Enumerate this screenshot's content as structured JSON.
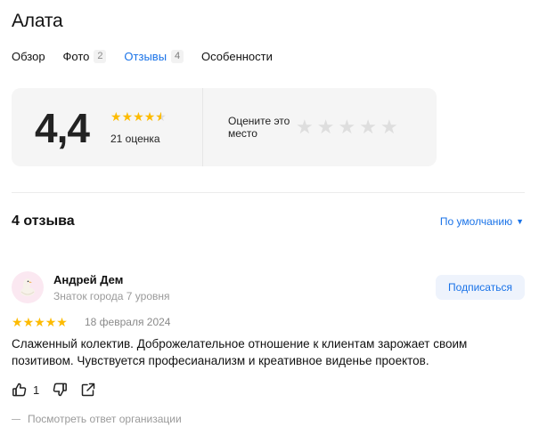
{
  "place": {
    "title": "Алата"
  },
  "tabs": [
    {
      "label": "Обзор",
      "count": ""
    },
    {
      "label": "Фото",
      "count": "2"
    },
    {
      "label": "Отзывы",
      "count": "4"
    },
    {
      "label": "Особенности",
      "count": ""
    }
  ],
  "active_tab": "Отзывы",
  "rating": {
    "score": "4,4",
    "stars_value": 4.4,
    "count_label": "21 оценка",
    "rate_prompt": "Оцените это место",
    "rate_stars": 5
  },
  "reviews_section": {
    "heading": "4 отзыва",
    "sort_label": "По умолчанию"
  },
  "review": {
    "author": "Андрей Дем",
    "level": "Знаток города 7 уровня",
    "subscribe_label": "Подписаться",
    "stars": 5,
    "date": "18 февраля 2024",
    "text": "Слаженный колектив. Доброжелательное отношение к клиентам зарожает своим позитивом. Чувствуется професианализм и креативное виденье проектов.",
    "likes": "1",
    "org_reply_label": "Посмотреть ответ организации"
  },
  "colors": {
    "accent": "#1a73e8",
    "star": "#fdbb00",
    "card_bg": "#f5f5f5"
  }
}
